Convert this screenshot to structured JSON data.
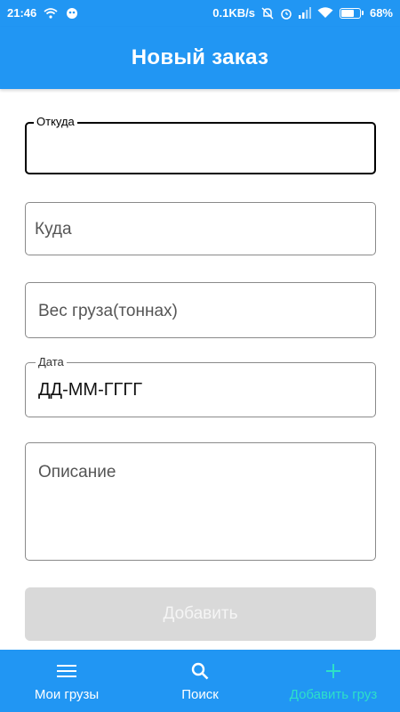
{
  "status_bar": {
    "time": "21:46",
    "network_speed": "0.1KB/s",
    "battery_percent": "68%",
    "battery_level": 0.68,
    "icons": [
      "wifi-icon",
      "notification-icon",
      "mute-icon",
      "alarm-icon",
      "signal-icon",
      "wifi-icon",
      "battery-icon"
    ]
  },
  "app_bar": {
    "title": "Новый заказ"
  },
  "form": {
    "from": {
      "label": "Откуда",
      "value": ""
    },
    "to": {
      "placeholder": "Куда"
    },
    "weight": {
      "placeholder": "Вес груза(тоннах)"
    },
    "date": {
      "label": "Дата",
      "value": "ДД-ММ-ГГГГ"
    },
    "description": {
      "placeholder": "Описание"
    },
    "submit_label": "Добавить"
  },
  "bottom_nav": {
    "items": [
      {
        "label": "Мои грузы",
        "icon": "menu-icon",
        "active": false
      },
      {
        "label": "Поиск",
        "icon": "search-icon",
        "active": false
      },
      {
        "label": "Добавить груз",
        "icon": "plus-icon",
        "active": true
      }
    ]
  },
  "colors": {
    "primary": "#2196f3",
    "active_nav": "#2de0c8",
    "disabled_button": "#d9d9d9"
  }
}
